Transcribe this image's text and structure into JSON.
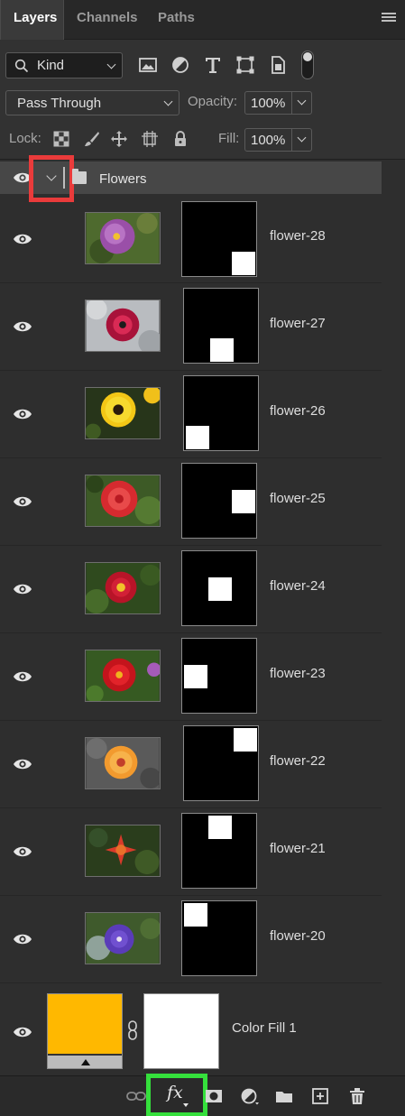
{
  "tabs": [
    {
      "label": "Layers",
      "active": true
    },
    {
      "label": "Channels",
      "active": false
    },
    {
      "label": "Paths",
      "active": false
    }
  ],
  "filter": {
    "kind_label": "Kind",
    "icons": [
      "pixel-layer-filter-icon",
      "adjustment-layer-filter-icon",
      "type-layer-filter-icon",
      "shape-layer-filter-icon",
      "smart-object-filter-icon",
      "filter-toggle"
    ]
  },
  "blend": {
    "mode": "Pass Through",
    "opacity_label": "Opacity:",
    "opacity_value": "100%"
  },
  "lock": {
    "label": "Lock:",
    "fill_label": "Fill:",
    "fill_value": "100%"
  },
  "group": {
    "name": "Flowers",
    "expanded": true
  },
  "layers": [
    {
      "name": "flower-28",
      "mask_cell": "bottom-right"
    },
    {
      "name": "flower-27",
      "mask_cell": "bottom-center"
    },
    {
      "name": "flower-26",
      "mask_cell": "bottom-left"
    },
    {
      "name": "flower-25",
      "mask_cell": "middle-right"
    },
    {
      "name": "flower-24",
      "mask_cell": "middle-center"
    },
    {
      "name": "flower-23",
      "mask_cell": "middle-left"
    },
    {
      "name": "flower-22",
      "mask_cell": "top-right"
    },
    {
      "name": "flower-21",
      "mask_cell": "top-center"
    },
    {
      "name": "flower-20",
      "mask_cell": "top-left"
    }
  ],
  "fill_layer": {
    "name": "Color Fill 1",
    "color": "#ffb800"
  },
  "bottom_icons": [
    "link-layers-icon",
    "fx-icon",
    "add-mask-icon",
    "adjustment-layer-icon",
    "new-group-icon",
    "new-layer-icon",
    "delete-layer-icon"
  ],
  "highlight_colors": {
    "red": "#ea3b3b",
    "green": "#35e03c"
  }
}
